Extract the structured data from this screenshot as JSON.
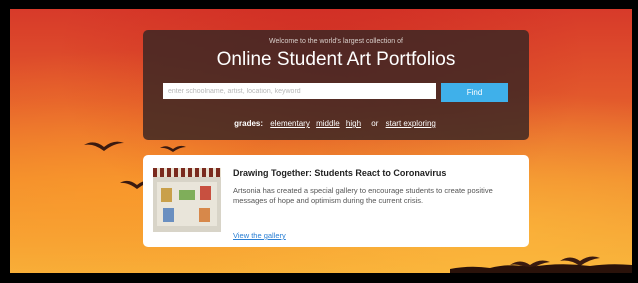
{
  "hero": {
    "welcome_text": "Welcome to the world's largest collection of",
    "title": "Online Student Art Portfolios"
  },
  "search": {
    "placeholder": "enter schoolname, artist, location, keyword",
    "button_label": "Find"
  },
  "grades": {
    "label": "grades:",
    "links": [
      "elementary",
      "middle",
      "high"
    ],
    "or_text": "or",
    "explore_label": "start exploring"
  },
  "feature": {
    "title": "Drawing Together: Students React to Coronavirus",
    "body": "Artsonia has created a special gallery to encourage students to create positive messages of hope and optimism during the current crisis.",
    "link_label": "View the gallery"
  },
  "colors": {
    "accent": "#3fb0ea",
    "panel": "#3a2624",
    "link": "#2a7fd4"
  }
}
